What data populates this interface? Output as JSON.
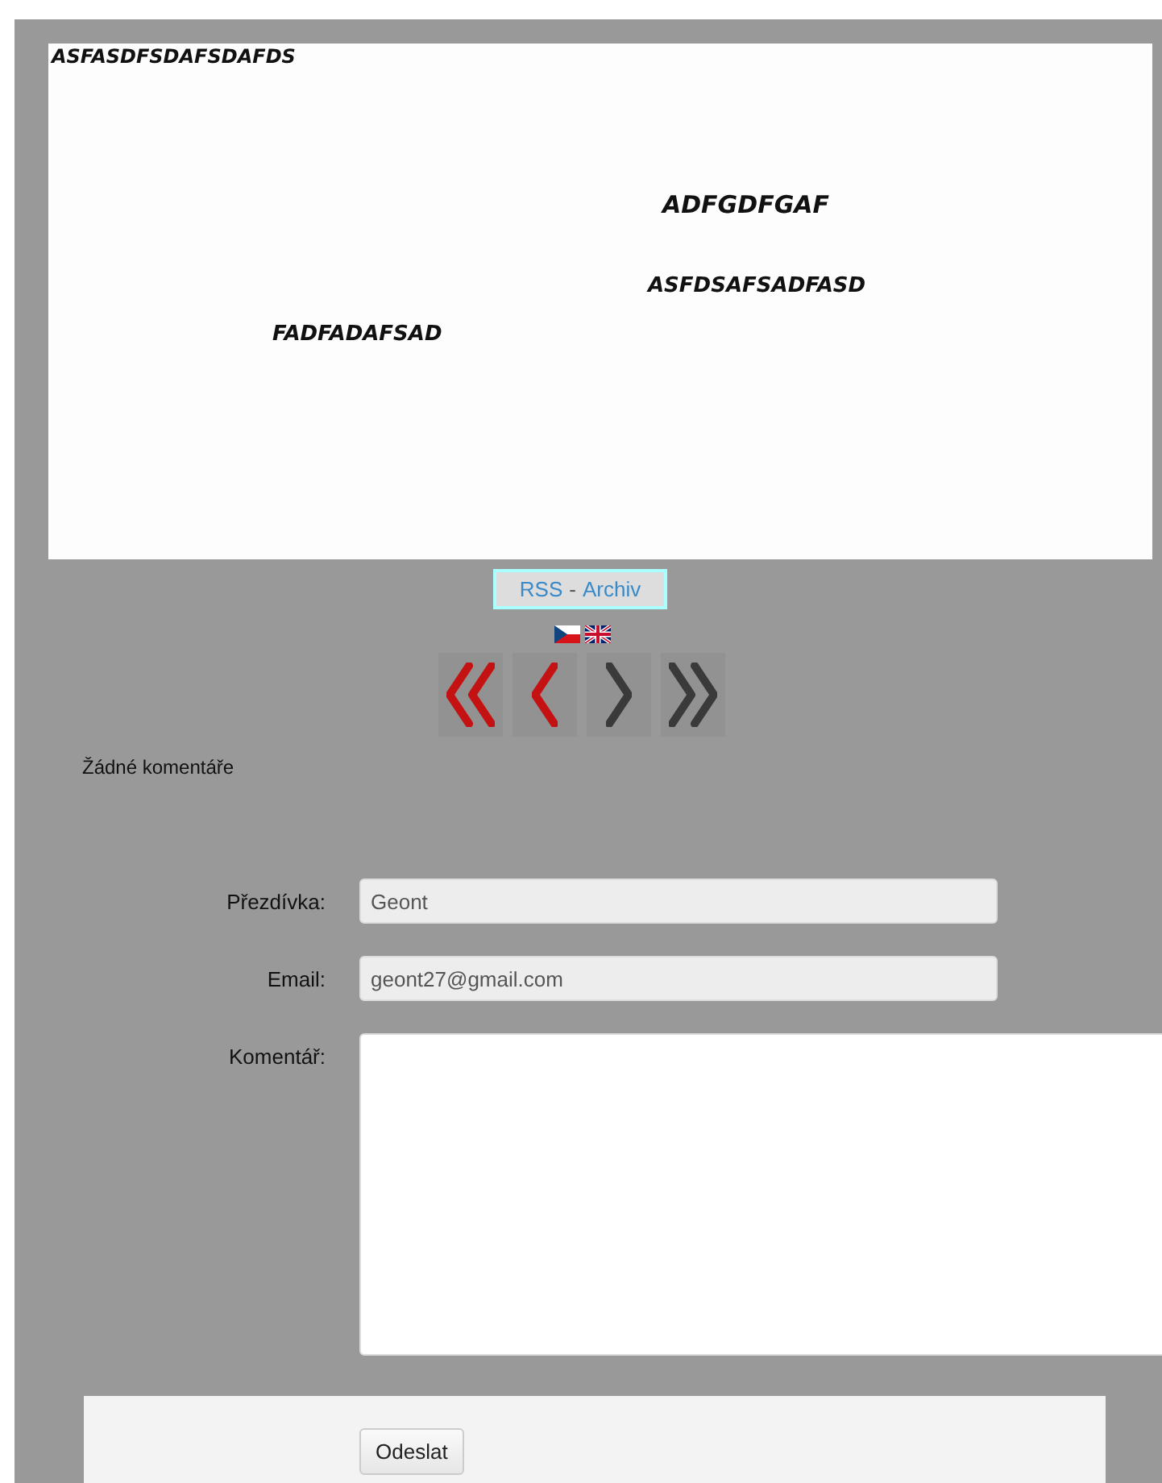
{
  "canvas": {
    "texts": [
      "ASFASDFSDAFSDAFDS",
      "ADFGDFGAF",
      "ASFDSAFSADFASD",
      "FADFADAFSAD"
    ]
  },
  "links": {
    "rss": "RSS",
    "separator": "-",
    "archive": "Archiv"
  },
  "languages": [
    {
      "kind": "cz"
    },
    {
      "kind": "uk"
    }
  ],
  "navigation": [
    {
      "kind": "first",
      "color": "#c41212"
    },
    {
      "kind": "previous",
      "color": "#c41212"
    },
    {
      "kind": "next",
      "color": "#3a3a3a"
    },
    {
      "kind": "last",
      "color": "#3a3a3a"
    }
  ],
  "comments_status": "Žádné komentáře",
  "form": {
    "fields": [
      {
        "label": "Přezdívka:",
        "kind": "input",
        "value": "Geont"
      },
      {
        "label": "Email:",
        "kind": "input",
        "value": "geont27@gmail.com"
      },
      {
        "label": "Komentář:",
        "kind": "textarea"
      }
    ],
    "submit": "Odeslat"
  }
}
